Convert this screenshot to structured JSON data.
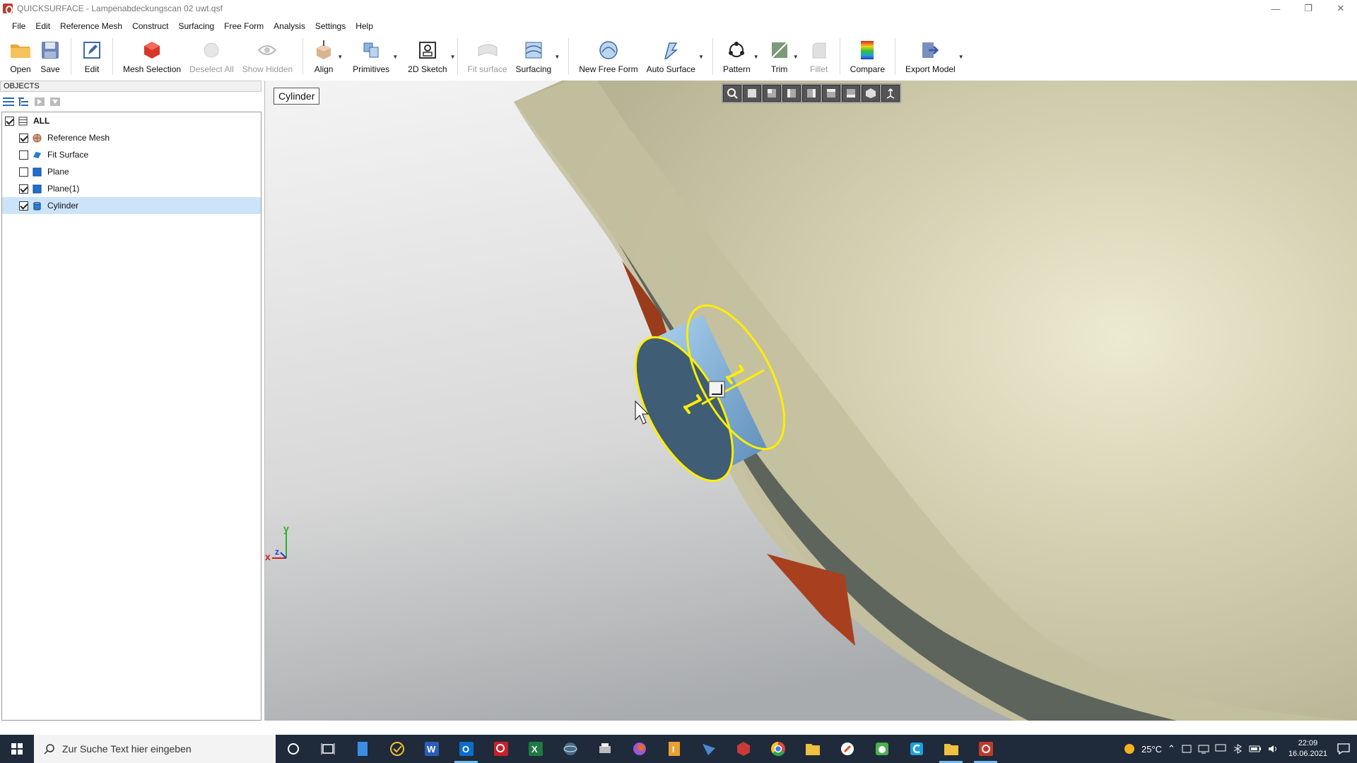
{
  "window": {
    "title": "QUICKSURFACE - Lampenabdeckungscan 02 uwt.qsf",
    "minimize_glyph": "—",
    "restore_glyph": "❐",
    "close_glyph": "✕"
  },
  "menu": [
    "File",
    "Edit",
    "Reference Mesh",
    "Construct",
    "Surfacing",
    "Free Form",
    "Analysis",
    "Settings",
    "Help"
  ],
  "toolbar": {
    "open": "Open",
    "save": "Save",
    "edit": "Edit",
    "mesh_selection": "Mesh Selection",
    "deselect_all": "Deselect All",
    "show_hidden": "Show Hidden",
    "align": "Align",
    "primitives": "Primitives",
    "sketch_2d": "2D Sketch",
    "fit_surface": "Fit surface",
    "surfacing": "Surfacing",
    "new_free_form": "New Free Form",
    "auto_surface": "Auto Surface",
    "pattern": "Pattern",
    "trim": "Trim",
    "fillet": "Fillet",
    "compare": "Compare",
    "export_model": "Export Model"
  },
  "objects_panel": {
    "header": "OBJECTS",
    "root_label": "ALL",
    "items": [
      {
        "label": "Reference Mesh",
        "checked": true
      },
      {
        "label": "Fit Surface",
        "checked": false
      },
      {
        "label": "Plane",
        "checked": false
      },
      {
        "label": "Plane(1)",
        "checked": true
      },
      {
        "label": "Cylinder",
        "checked": true,
        "selected": true
      }
    ]
  },
  "viewport": {
    "active_object_label": "Cylinder",
    "axis_x": "x",
    "axis_y": "y",
    "axis_z": "z"
  },
  "taskbar": {
    "search_placeholder": "Zur Suche Text hier eingeben",
    "temperature": "25°C",
    "time": "22:09",
    "date": "16.06.2021"
  },
  "colors": {
    "mesh": "#c9c5a8",
    "plane": "#9a3b1c",
    "cylinder": "#7fb0d6",
    "highlight": "#ffee00",
    "taskbar": "#1f2a3a"
  }
}
